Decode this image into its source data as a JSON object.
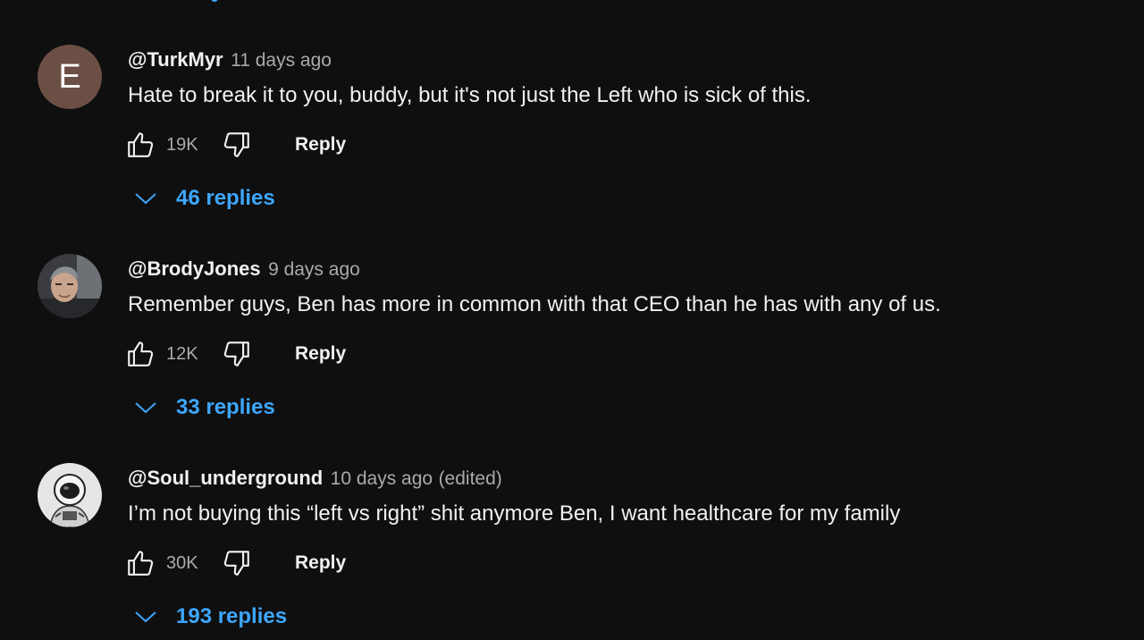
{
  "comments": [
    {
      "author": "@TurkMyr",
      "avatar_letter": "E",
      "avatar_color": "#6b4f45",
      "time": "11 days ago",
      "edited": "",
      "text": "Hate to break it to you, buddy, but it's not just the Left who is sick of this.",
      "likes": "19K",
      "reply_label": "Reply",
      "replies_label": "46 replies"
    },
    {
      "author": "@BrodyJones",
      "time": "9 days ago",
      "edited": "",
      "text": "Remember guys, Ben has more in common with that CEO than he has with any of us.",
      "likes": "12K",
      "reply_label": "Reply",
      "replies_label": "33 replies"
    },
    {
      "author": "@Soul_underground",
      "time": "10 days ago",
      "edited": "(edited)",
      "text": "I’m not buying this “left vs right” shit anymore Ben, I want healthcare for my family",
      "likes": "30K",
      "reply_label": "Reply",
      "replies_label": "193 replies"
    }
  ],
  "icons": {
    "like": "thumbs-up-icon",
    "dislike": "thumbs-down-icon",
    "expand": "chevron-down-icon"
  },
  "colors": {
    "background": "#0f0f0f",
    "text": "#f1f1f1",
    "secondary_text": "#aaaaaa",
    "link": "#3ea6ff"
  }
}
